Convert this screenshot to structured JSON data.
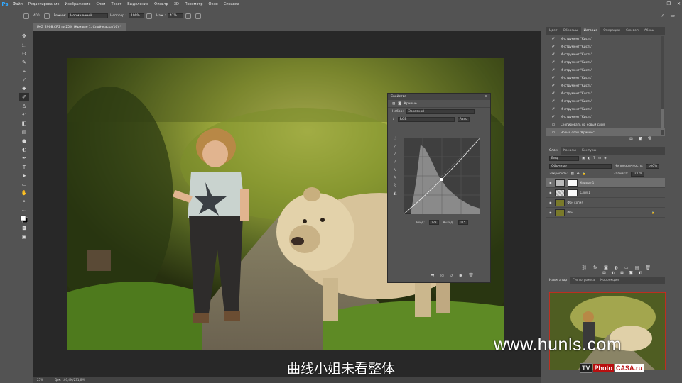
{
  "menubar": {
    "logo": "Ps",
    "items": [
      "Файл",
      "Редактирование",
      "Изображение",
      "Слои",
      "Текст",
      "Выделение",
      "Фильтр",
      "3D",
      "Просмотр",
      "Окно",
      "Справка"
    ]
  },
  "options": {
    "brush_size": "400",
    "mode_label": "Режим:",
    "mode_value": "Нормальный",
    "opacity_label": "Непрозр.:",
    "opacity_value": "100%",
    "flow_label": "Наж.:",
    "flow_value": "47%"
  },
  "document": {
    "tab_title": "IMG_2908.CR2 @ 25% (Кривые 1, Слой-маска/16) *",
    "zoom": "25%",
    "doc_size": "Док: 103,4М/231,6М"
  },
  "properties": {
    "header": "Свойства",
    "title": "Кривые",
    "preset_label": "Набор:",
    "preset_value": "Заказной",
    "channel": "RGB",
    "auto_label": "Авто",
    "input_label": "Вход:",
    "input_value": "128",
    "output_label": "Выход:",
    "output_value": "115"
  },
  "history_panel": {
    "tabs": [
      "Цвет",
      "Образцы",
      "История",
      "Операции",
      "Символ",
      "Абзац"
    ],
    "items": [
      "Инструмент \"Кисть\"",
      "Инструмент \"Кисть\"",
      "Инструмент \"Кисть\"",
      "Инструмент \"Кисть\"",
      "Инструмент \"Кисть\"",
      "Инструмент \"Кисть\"",
      "Инструмент \"Кисть\"",
      "Инструмент \"Кисть\"",
      "Инструмент \"Кисть\"",
      "Инструмент \"Кисть\"",
      "Инструмент \"Кисть\"",
      "Скопировать на новый слой",
      "Новый слой \"Кривые\""
    ]
  },
  "layers_panel": {
    "tabs": [
      "Слои",
      "Каналы",
      "Контуры"
    ],
    "kind_label": "Вид",
    "blend_mode": "Обычные",
    "opacity_label": "Непрозрачность:",
    "opacity_value": "100%",
    "lock_label": "Закрепить:",
    "fill_label": "Заливка:",
    "fill_value": "100%",
    "layers": [
      {
        "name": "Кривые 1",
        "type": "adjustment"
      },
      {
        "name": "Слой 1",
        "type": "pixel"
      },
      {
        "name": "Фон копия",
        "type": "image"
      },
      {
        "name": "Фон",
        "type": "image"
      }
    ]
  },
  "navigator_panel": {
    "tabs": [
      "Навигатор",
      "Гистограмма",
      "Коррекция"
    ]
  },
  "overlay": {
    "subtitle": "曲线小姐未看整体",
    "watermark": "www.hunls.com",
    "logo_tv": "TV",
    "logo_photo": "Photo",
    "logo_casa": "CASA.ru"
  },
  "colors": {
    "ui_bg": "#535353",
    "canvas_bg": "#282828",
    "highlight": "#31a8ff",
    "logo_red": "#b80f0f"
  }
}
